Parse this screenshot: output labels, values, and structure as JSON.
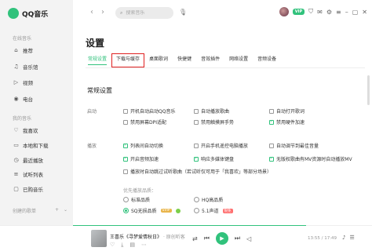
{
  "app": {
    "name": "QQ音乐",
    "brand_color": "#31c27c"
  },
  "sidebar": {
    "online_title": "在线音乐",
    "online_items": [
      {
        "label": "推荐",
        "icon": "home-icon",
        "glyph": "⌂"
      },
      {
        "label": "音乐馆",
        "icon": "music-note-icon",
        "glyph": "♫"
      },
      {
        "label": "视频",
        "icon": "video-icon",
        "glyph": "▷"
      },
      {
        "label": "电台",
        "icon": "radio-icon",
        "glyph": "◉"
      }
    ],
    "mine_title": "我的音乐",
    "mine_items": [
      {
        "label": "我喜欢",
        "icon": "heart-icon",
        "glyph": "♡"
      },
      {
        "label": "本地和下载",
        "icon": "download-icon",
        "glyph": "▭"
      },
      {
        "label": "最近播放",
        "icon": "clock-icon",
        "glyph": "◷"
      },
      {
        "label": "试听列表",
        "icon": "list-icon",
        "glyph": "≡"
      },
      {
        "label": "已购音乐",
        "icon": "bag-icon",
        "glyph": "▢"
      }
    ],
    "created_title": "创建的歌单",
    "created_add": "+",
    "created_more": "⌄"
  },
  "topbar": {
    "back": "‹",
    "forward": "›",
    "search_placeholder": "搜索音乐",
    "vip_badge": "VIP",
    "icons": [
      "shirt-icon",
      "mail-icon",
      "settings-icon",
      "menu-icon",
      "minimize-icon",
      "maximize-icon",
      "close-icon"
    ]
  },
  "settings": {
    "title": "设置",
    "tabs": [
      "常规设置",
      "下载与缓存",
      "桌面歌词",
      "快捷键",
      "音效插件",
      "网络设置",
      "音频设备"
    ],
    "active_tab": 0,
    "highlighted_tab": 1,
    "general_title": "常规设置",
    "startup": {
      "label": "启动",
      "options": [
        {
          "label": "开机自动启动QQ音乐",
          "checked": false
        },
        {
          "label": "自动播放歌曲",
          "checked": false
        },
        {
          "label": "自动打开歌词",
          "checked": false
        },
        {
          "label": "禁用屏幕DPI适配",
          "checked": false
        },
        {
          "label": "禁用触摸屏手势",
          "checked": false
        },
        {
          "label": "禁用硬件加速",
          "checked": true
        }
      ]
    },
    "playback": {
      "label": "播放",
      "options": [
        {
          "label": "列表间自动切换",
          "checked": true
        },
        {
          "label": "开启手机遥控电脑播放",
          "checked": false
        },
        {
          "label": "自动调节到最佳音量",
          "checked": false
        },
        {
          "label": "开启音频加速",
          "checked": true
        },
        {
          "label": "响应多媒体键盘",
          "checked": true
        },
        {
          "label": "无版权歌曲有MV资源时自动播放MV",
          "checked": true
        },
        {
          "label": "播放时自动跳过试听歌曲（若试听仅可用于「我喜欢」等部分场景）",
          "checked": false
        }
      ],
      "quality_title": "优先播放品质：",
      "quality_options": [
        {
          "label": "标准品质",
          "selected": false,
          "tag": ""
        },
        {
          "label": "HQ高品质",
          "selected": false,
          "tag": ""
        },
        {
          "label": "SQ无损品质",
          "selected": true,
          "tag": "svip"
        },
        {
          "label": "5.1声道",
          "selected": false,
          "tag": "new"
        }
      ],
      "svip_tag": "SVIP",
      "new_tag": "限免"
    }
  },
  "player": {
    "song": "王喜乐《寻梦爱情秋日》",
    "artist": "· 原创听客",
    "time": "13:55 / 17:49",
    "progress": 0.78,
    "icons": {
      "like": "♡",
      "download": "⤓",
      "comment": "▤",
      "more": "⋯",
      "mode": "⇄",
      "prev": "⏮",
      "play": "▶",
      "next": "⏭",
      "volume": "◁"
    },
    "right_icons": [
      "♪",
      "☰"
    ]
  }
}
